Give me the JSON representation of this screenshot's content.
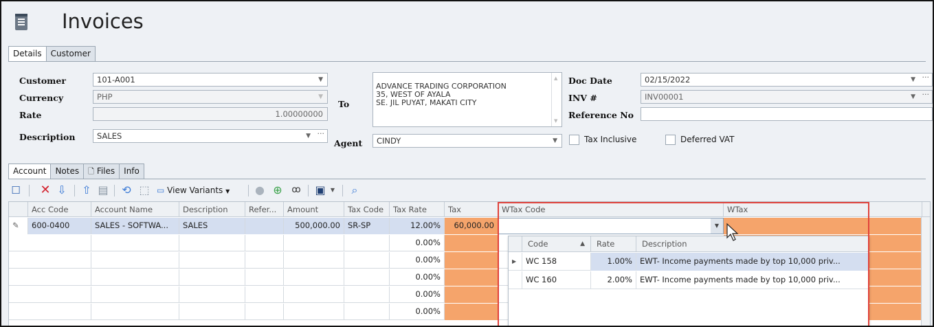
{
  "window": {
    "title": "Invoices"
  },
  "top_tabs": [
    {
      "label": "Details",
      "active": true
    },
    {
      "label": "Customer",
      "active": false
    }
  ],
  "form": {
    "customer": {
      "label": "Customer",
      "value": "101-A001"
    },
    "currency": {
      "label": "Currency",
      "value": "PHP"
    },
    "rate": {
      "label": "Rate",
      "value": "1.00000000"
    },
    "description": {
      "label": "Description",
      "value": "SALES"
    },
    "to": {
      "label": "To",
      "lines": "ADVANCE TRADING CORPORATION\n35, WEST OF AYALA\nSE. JIL PUYAT, MAKATI CITY"
    },
    "agent": {
      "label": "Agent",
      "value": "CINDY"
    },
    "doc_date": {
      "label": "Doc Date",
      "value": "02/15/2022"
    },
    "inv_no": {
      "label": "INV #",
      "value": "INV00001"
    },
    "reference_no": {
      "label": "Reference No",
      "value": ""
    },
    "tax_inclusive": {
      "label": "Tax Inclusive",
      "checked": false
    },
    "deferred_vat": {
      "label": "Deferred VAT",
      "checked": false
    }
  },
  "bottom_tabs": [
    {
      "label": "Account",
      "active": true
    },
    {
      "label": "Notes"
    },
    {
      "label": "Files"
    },
    {
      "label": "Info"
    }
  ],
  "toolbar": {
    "view_variants_label": "View Variants"
  },
  "grid": {
    "columns": [
      "Acc Code",
      "Account Name",
      "Description",
      "Refer...",
      "Amount",
      "Tax Code",
      "Tax Rate",
      "Tax",
      "WTax Code",
      "WTax"
    ],
    "rows": [
      {
        "acc_code": "600-0400",
        "account_name": "SALES - SOFTWA...",
        "description": "SALES",
        "reference": "",
        "amount": "500,000.00",
        "tax_code": "SR-SP",
        "tax_rate": "12.00%",
        "tax": "60,000.00"
      },
      {
        "tax_rate": "0.00%"
      },
      {
        "tax_rate": "0.00%"
      },
      {
        "tax_rate": "0.00%"
      },
      {
        "tax_rate": "0.00%"
      },
      {
        "tax_rate": "0.00%"
      }
    ]
  },
  "wtax_dropdown": {
    "columns": [
      "Code",
      "Rate",
      "Description"
    ],
    "rows": [
      {
        "code": "WC 158",
        "rate": "1.00%",
        "description": "EWT- Income payments made by top 10,000 priv..."
      },
      {
        "code": "WC 160",
        "rate": "2.00%",
        "description": "EWT- Income payments made by top 10,000 priv..."
      }
    ]
  },
  "colors": {
    "highlight_orange": "#f5a46b",
    "selection_blue": "#d4def0",
    "annotation_red": "#e0413a"
  }
}
